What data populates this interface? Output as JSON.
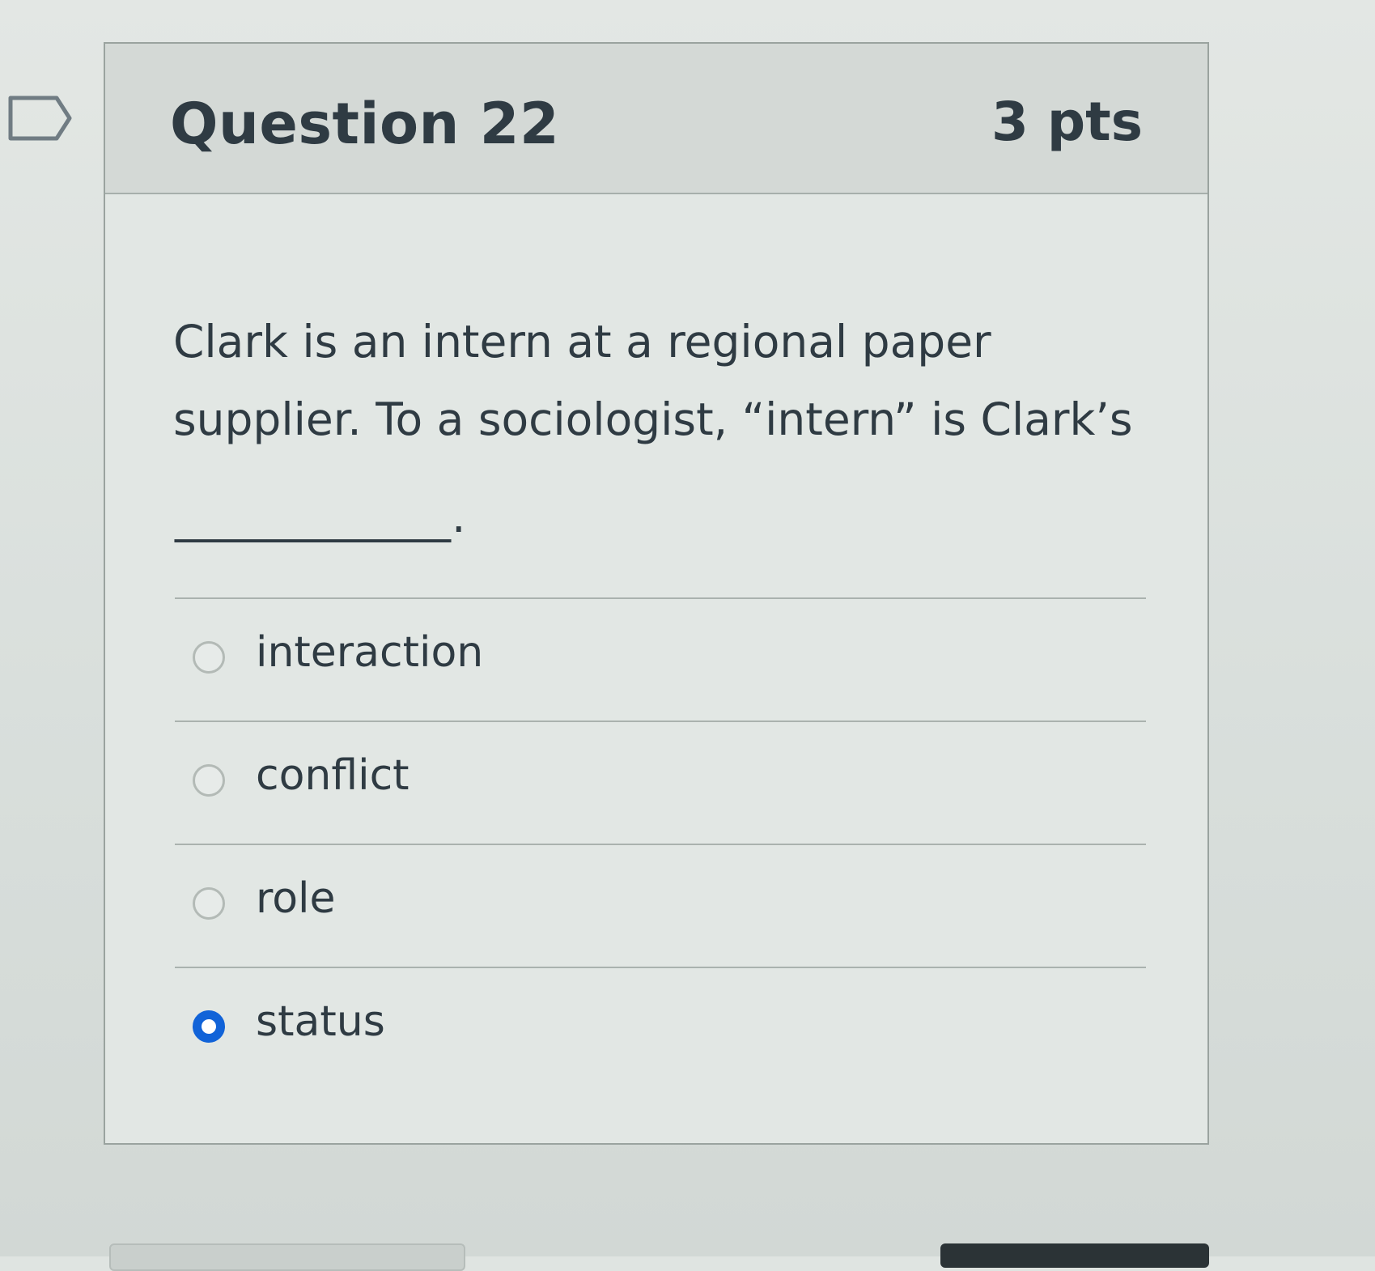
{
  "question": {
    "title": "Question 22",
    "points": "3 pts",
    "text": "Clark is an intern at a regional paper supplier. To a sociologist, “intern” is Clark’s",
    "blank": "____________."
  },
  "answers": [
    {
      "label": "interaction",
      "selected": false
    },
    {
      "label": "conflict",
      "selected": false
    },
    {
      "label": "role",
      "selected": false
    },
    {
      "label": "status",
      "selected": true
    }
  ],
  "icons": {
    "flag": "flag-icon"
  },
  "colors": {
    "selected_radio": "#1163d8"
  }
}
